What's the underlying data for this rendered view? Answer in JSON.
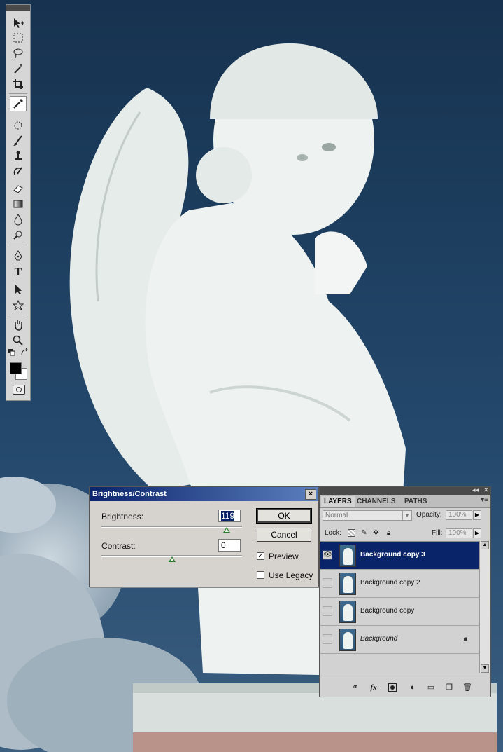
{
  "dialog": {
    "title": "Brightness/Contrast",
    "close_label": "×",
    "brightness_label": "Brightness:",
    "brightness_value": "119",
    "contrast_label": "Contrast:",
    "contrast_value": "0",
    "ok_label": "OK",
    "cancel_label": "Cancel",
    "preview_label": "Preview",
    "preview_checked": true,
    "use_legacy_label": "Use Legacy",
    "use_legacy_checked": false
  },
  "layers_panel": {
    "tabs": [
      "LAYERS",
      "CHANNELS",
      "PATHS"
    ],
    "active_tab": "LAYERS",
    "blend_mode": "Normal",
    "opacity_label": "Opacity:",
    "opacity_value": "100%",
    "lock_label": "Lock:",
    "fill_label": "Fill:",
    "fill_value": "100%",
    "layers": [
      {
        "name": "Background copy 3",
        "visible": true,
        "selected": true
      },
      {
        "name": "Background copy 2",
        "visible": false,
        "selected": false
      },
      {
        "name": "Background copy",
        "visible": false,
        "selected": false
      },
      {
        "name": "Background",
        "visible": false,
        "selected": false,
        "locked": true
      }
    ],
    "bottom_icons": [
      "link-icon",
      "fx-icon",
      "mask-icon",
      "adjustment-icon",
      "group-folder-icon",
      "new-layer-icon",
      "trash-icon"
    ],
    "fx_label": "fx"
  },
  "tools": {
    "items": [
      "move-tool",
      "marquee-tool",
      "lasso-tool",
      "magic-wand-tool",
      "crop-tool",
      "eyedropper-tool",
      "healing-brush-tool",
      "brush-tool",
      "clone-stamp-tool",
      "history-brush-tool",
      "eraser-tool",
      "gradient-tool",
      "blur-tool",
      "dodge-tool",
      "pen-tool",
      "type-tool",
      "path-selection-tool",
      "shape-tool",
      "hand-tool",
      "zoom-tool"
    ],
    "active": "eyedropper-tool",
    "type_tool_glyph": "T",
    "foreground_color": "#000000",
    "background_color": "#ffffff"
  }
}
